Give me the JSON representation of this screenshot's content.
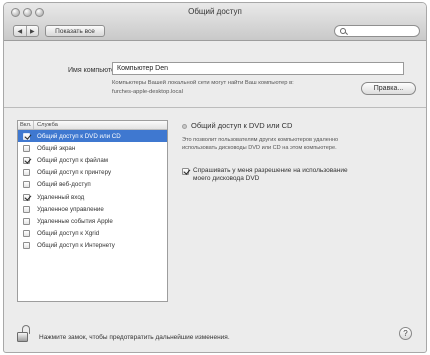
{
  "window": {
    "title": "Общий доступ"
  },
  "toolbar": {
    "back_glyph": "◀",
    "forward_glyph": "▶",
    "show_all_label": "Показать все",
    "search_placeholder": "",
    "search_icon": "search-icon"
  },
  "computer_name": {
    "label": "Имя компьютера:",
    "value": "Компьютер Den",
    "hint_line1": "Компьютеры Вашей локальной сети могут найти Ваш компьютер в:",
    "hint_line2": "furches-apple-desktop.local",
    "edit_label": "Правка..."
  },
  "services": {
    "header_on": "Вкл.",
    "header_service": "Служба",
    "items": [
      {
        "label": "Общий доступ к DVD или CD",
        "checked": true,
        "selected": true
      },
      {
        "label": "Общий экран",
        "checked": false,
        "selected": false
      },
      {
        "label": "Общий доступ к файлам",
        "checked": true,
        "selected": false
      },
      {
        "label": "Общий доступ к принтеру",
        "checked": false,
        "selected": false
      },
      {
        "label": "Общий веб-доступ",
        "checked": false,
        "selected": false
      },
      {
        "label": "Удаленный вход",
        "checked": true,
        "selected": false
      },
      {
        "label": "Удаленное управление",
        "checked": false,
        "selected": false
      },
      {
        "label": "Удаленные события Apple",
        "checked": false,
        "selected": false
      },
      {
        "label": "Общий доступ к Xgrid",
        "checked": false,
        "selected": false
      },
      {
        "label": "Общий доступ к Интернету",
        "checked": false,
        "selected": false
      }
    ]
  },
  "detail": {
    "title": "Общий доступ к DVD или CD",
    "description_line1": "Это позволит пользователям других компьютеров удаленно",
    "description_line2": "использовать дисководы DVD или CD на этом компьютере.",
    "ask_checked": true,
    "ask_line1": "Спрашивать у меня разрешение на использование",
    "ask_line2": "моего дисковода DVD"
  },
  "footer": {
    "lock_text": "Нажмите замок, чтобы предотвратить дальнейшие изменения.",
    "help_glyph": "?"
  }
}
